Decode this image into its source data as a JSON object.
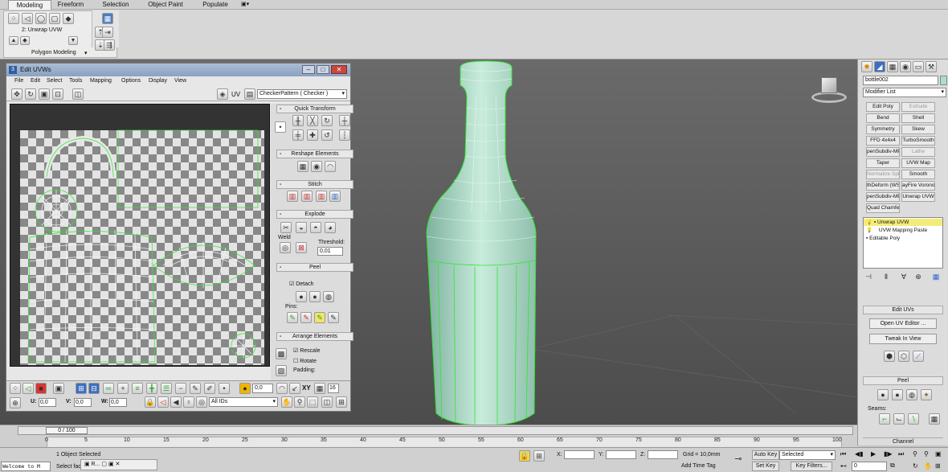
{
  "ribbon": {
    "tabs": [
      "Modeling",
      "Freeform",
      "Selection",
      "Object Paint",
      "Populate"
    ],
    "stack_label": "2: Unwrap UVW",
    "panel_label": "Polygon Modeling"
  },
  "uv_window": {
    "title": "Edit UVWs",
    "menus": [
      "File",
      "Edit",
      "Select",
      "Tools",
      "Mapping",
      "Options",
      "Display",
      "View"
    ],
    "uv_label": "UV",
    "texture_dropdown": "CheckerPattern  ( Checker )",
    "rollouts": {
      "quick_transform": "Quick Transform",
      "reshape": "Reshape Elements",
      "stitch": "Stitch",
      "explode": "Explode",
      "weld": "Weld",
      "threshold": "Threshold:",
      "threshold_value": "0,01",
      "peel": "Peel",
      "detach": "Detach",
      "pins": "Pins:",
      "arrange": "Arrange Elements",
      "rescale": "Rescale",
      "rotate": "Rotate",
      "padding": "Padding:"
    },
    "bottom": {
      "spinner_value": "0,0",
      "xy": "XY",
      "zoom": "16",
      "u_label": "U:",
      "u_value": "0,0",
      "v_label": "V:",
      "v_value": "0,0",
      "w_label": "W:",
      "w_value": "0,0",
      "ids": "All IDs"
    }
  },
  "command_panel": {
    "object_name": "bottle002",
    "modifier_list": "Modifier List",
    "modifiers": [
      [
        "Edit Poly",
        "Extrude"
      ],
      [
        "Bend",
        "Shell"
      ],
      [
        "Symmetry",
        "Skew"
      ],
      [
        "FFD 4x4x4",
        "TurboSmooth"
      ],
      [
        "penSubdiv-MP",
        "Lathe"
      ],
      [
        "Taper",
        "UVW Map"
      ],
      [
        "Normalize Spl.",
        "Smooth"
      ],
      [
        "thDeform (WSI",
        "ayFire Vorono"
      ],
      [
        "penSubdiv-MP",
        "Unwrap UVW"
      ],
      [
        "Quad Chamfer",
        ""
      ]
    ],
    "disabled": [
      "Extrude",
      "Lathe",
      "Normalize Spl."
    ],
    "stack": [
      "Unwrap UVW",
      "UVW Mapping Paste",
      "Editable Poly"
    ],
    "edit_uvs": "Edit UVs",
    "open_uv_editor": "Open UV Editor ...",
    "tweak_in_view": "Tweak In View",
    "peel": "Peel",
    "seams": "Seams:",
    "channel": "Channel"
  },
  "timeline": {
    "frame": "0 / 100",
    "ticks": [
      "0",
      "5",
      "10",
      "15",
      "20",
      "25",
      "30",
      "35",
      "40",
      "45",
      "50",
      "55",
      "60",
      "65",
      "70",
      "75",
      "80",
      "85",
      "90",
      "95",
      "100"
    ]
  },
  "status": {
    "maxscript": "Welcome to M",
    "selected": "1 Object Selected",
    "prompt": "Select fac",
    "x_label": "X:",
    "y_label": "Y:",
    "z_label": "Z:",
    "grid": "Grid = 10,0mm",
    "add_time_tag": "Add Time Tag",
    "auto_key": "Auto Key",
    "set_key": "Set Key",
    "key_mode": "Selected",
    "key_filters": "Key Filters...",
    "frame_value": "0"
  },
  "colors": {
    "viewport_top": "#6a6a6a",
    "viewport_bottom": "#4a4a4a",
    "wire": "#2ee82e",
    "bottle": "#a8d8c2"
  }
}
